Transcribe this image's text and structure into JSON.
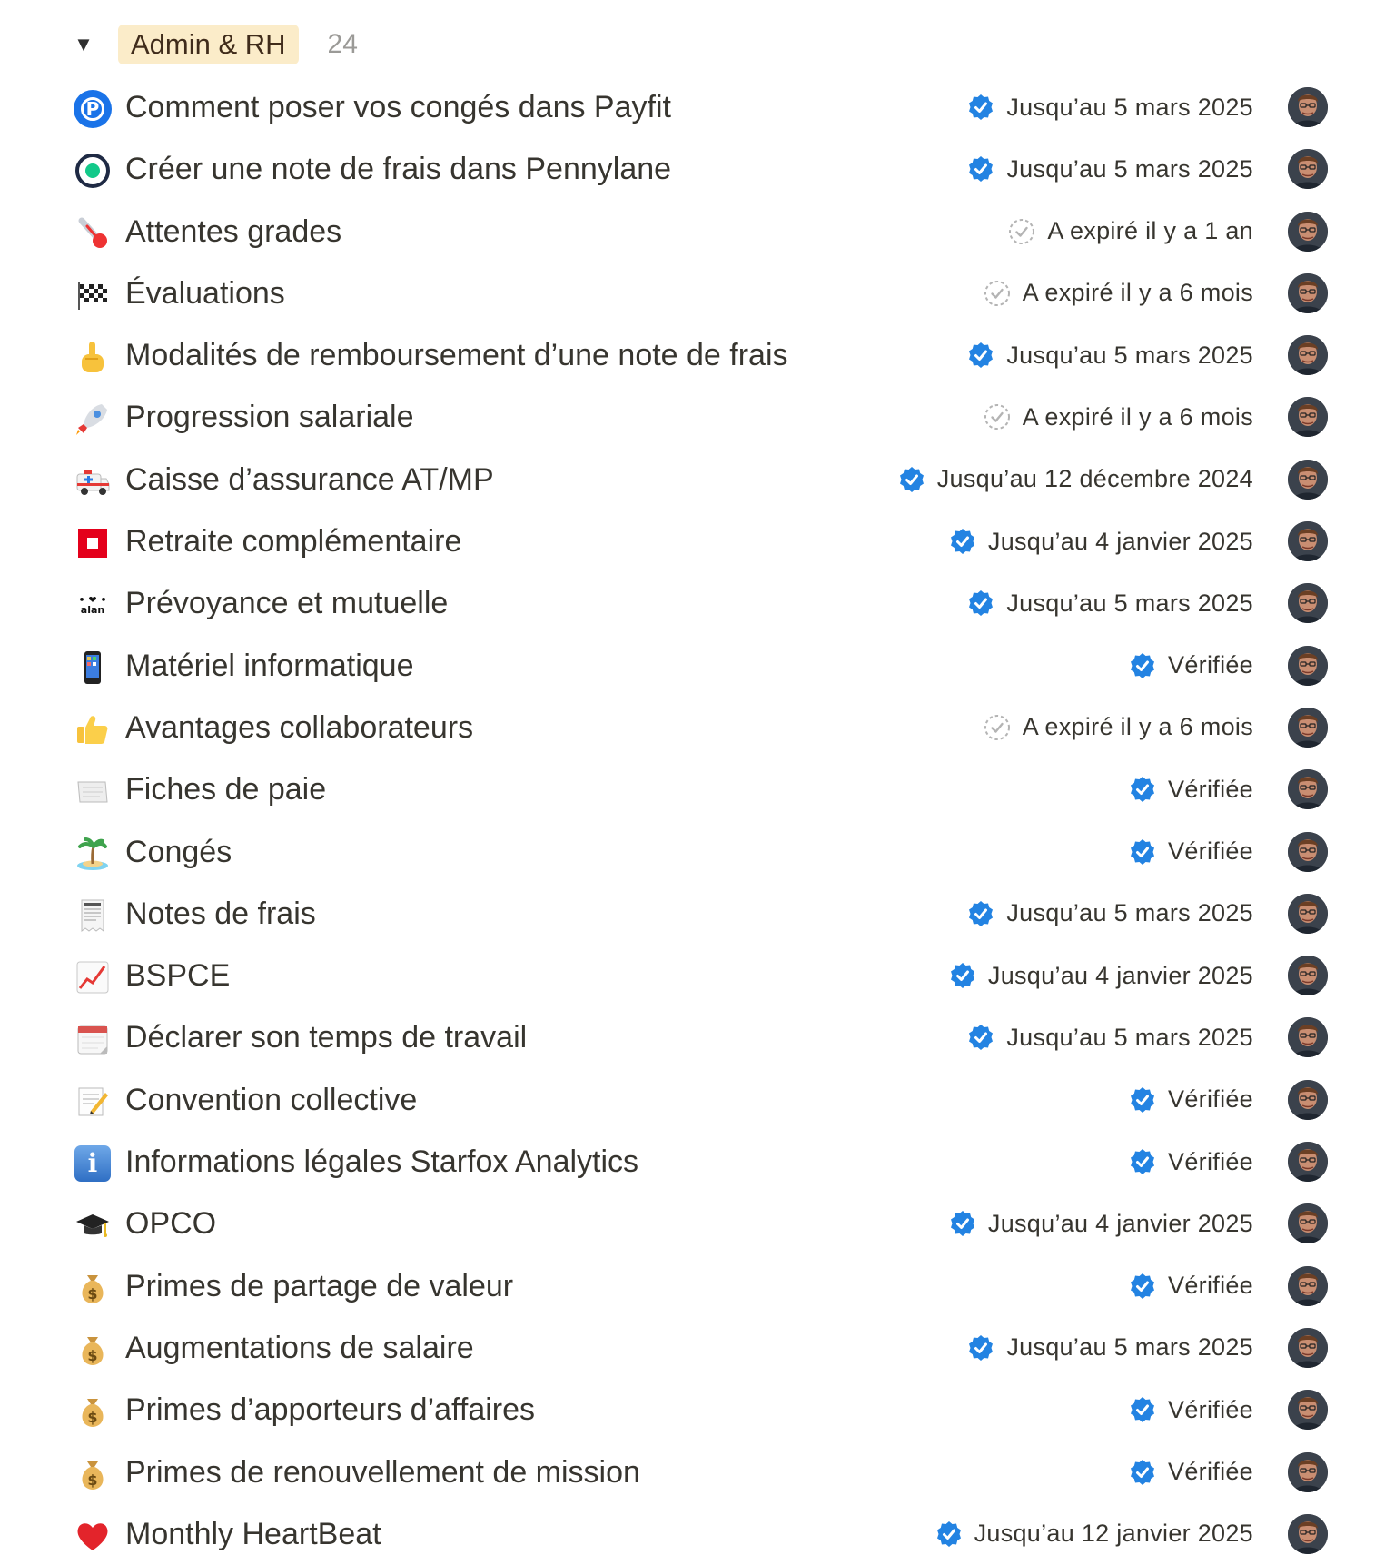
{
  "group": {
    "toggle_icon": "triangle-down-icon",
    "label": "Admin & RH",
    "count": "24"
  },
  "colors": {
    "verified": "#2383e2",
    "expired": "#b4b4b4",
    "pill_bg": "#fbecc9"
  },
  "rows": [
    {
      "icon": "payfit-icon",
      "title": "Comment poser vos congés dans Payfit",
      "status": "Jusqu’au 5 mars 2025",
      "verified": true
    },
    {
      "icon": "pennylane-icon",
      "title": "Créer une note de frais dans Pennylane",
      "status": "Jusqu’au 5 mars 2025",
      "verified": true
    },
    {
      "icon": "thermometer-icon",
      "title": "Attentes grades",
      "status": "A expiré il y a 1 an",
      "verified": false
    },
    {
      "icon": "checkered-flag-icon",
      "title": "Évaluations",
      "status": "A expiré il y a 6 mois",
      "verified": false
    },
    {
      "icon": "pointing-up-icon",
      "title": "Modalités de remboursement d’une note de frais",
      "status": "Jusqu’au 5 mars 2025",
      "verified": true
    },
    {
      "icon": "rocket-icon",
      "title": "Progression salariale",
      "status": "A expiré il y a 6 mois",
      "verified": false
    },
    {
      "icon": "ambulance-icon",
      "title": "Caisse d’assurance AT/MP",
      "status": "Jusqu’au 12 décembre 2024",
      "verified": true
    },
    {
      "icon": "retraite-logo-icon",
      "title": "Retraite complémentaire",
      "status": "Jusqu’au 4 janvier 2025",
      "verified": true
    },
    {
      "icon": "alan-logo-icon",
      "title": "Prévoyance et mutuelle",
      "status": "Jusqu’au 5 mars 2025",
      "verified": true
    },
    {
      "icon": "mobile-phone-icon",
      "title": "Matériel informatique",
      "status": "Vérifiée",
      "verified": true
    },
    {
      "icon": "thumbs-up-icon",
      "title": "Avantages collaborateurs",
      "status": "A expiré il y a 6 mois",
      "verified": false
    },
    {
      "icon": "page-icon",
      "title": "Fiches de paie",
      "status": "Vérifiée",
      "verified": true
    },
    {
      "icon": "desert-island-icon",
      "title": "Congés",
      "status": "Vérifiée",
      "verified": true
    },
    {
      "icon": "receipt-icon",
      "title": "Notes de frais",
      "status": "Jusqu’au 5 mars 2025",
      "verified": true
    },
    {
      "icon": "chart-increasing-icon",
      "title": "BSPCE",
      "status": "Jusqu’au 4 janvier 2025",
      "verified": true
    },
    {
      "icon": "calendar-icon",
      "title": "Déclarer son temps de travail",
      "status": "Jusqu’au 5 mars 2025",
      "verified": true
    },
    {
      "icon": "memo-icon",
      "title": "Convention collective",
      "status": "Vérifiée",
      "verified": true
    },
    {
      "icon": "information-icon",
      "title": "Informations légales Starfox Analytics",
      "status": "Vérifiée",
      "verified": true
    },
    {
      "icon": "graduation-cap-icon",
      "title": "OPCO",
      "status": "Jusqu’au 4 janvier 2025",
      "verified": true
    },
    {
      "icon": "money-bag-icon",
      "title": "Primes de partage de valeur",
      "status": "Vérifiée",
      "verified": true
    },
    {
      "icon": "money-bag-icon",
      "title": "Augmentations de salaire",
      "status": "Jusqu’au 5 mars 2025",
      "verified": true
    },
    {
      "icon": "money-bag-icon",
      "title": "Primes d’apporteurs d’affaires",
      "status": "Vérifiée",
      "verified": true
    },
    {
      "icon": "money-bag-icon",
      "title": "Primes de renouvellement de mission",
      "status": "Vérifiée",
      "verified": true
    },
    {
      "icon": "red-heart-icon",
      "title": "Monthly HeartBeat",
      "status": "Jusqu’au 12 janvier 2025",
      "verified": true
    }
  ]
}
